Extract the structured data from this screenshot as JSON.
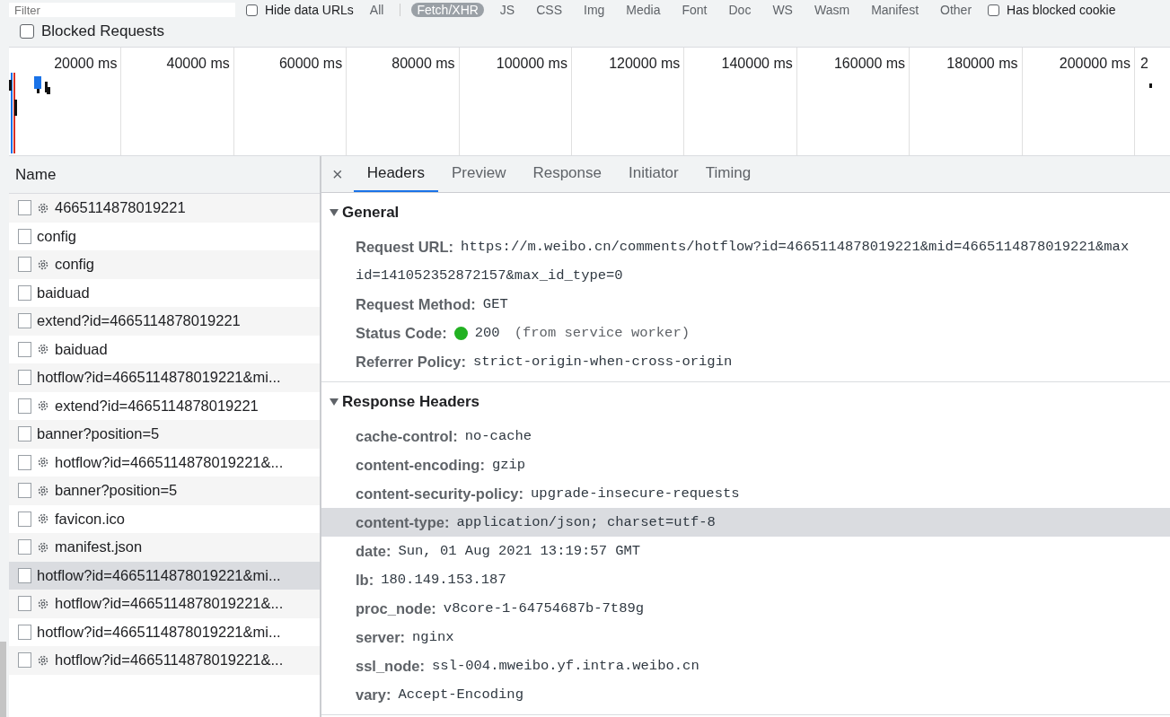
{
  "toolbar": {
    "filter": {
      "placeholder": "Filter"
    },
    "hide_data_urls": {
      "label": "Hide data URLs",
      "checked": false
    },
    "types": [
      {
        "label": "All",
        "selected": false
      },
      {
        "label": "Fetch/XHR",
        "selected": true
      },
      {
        "label": "JS",
        "selected": false
      },
      {
        "label": "CSS",
        "selected": false
      },
      {
        "label": "Img",
        "selected": false
      },
      {
        "label": "Media",
        "selected": false
      },
      {
        "label": "Font",
        "selected": false
      },
      {
        "label": "Doc",
        "selected": false
      },
      {
        "label": "WS",
        "selected": false
      },
      {
        "label": "Wasm",
        "selected": false
      },
      {
        "label": "Manifest",
        "selected": false
      },
      {
        "label": "Other",
        "selected": false
      }
    ],
    "has_blocked_cookies": {
      "label": "Has blocked cookie",
      "checked": false
    }
  },
  "blocked_requests": {
    "label": "Blocked Requests",
    "checked": false
  },
  "timeline": {
    "ticks": [
      "20000 ms",
      "40000 ms",
      "60000 ms",
      "80000 ms",
      "100000 ms",
      "120000 ms",
      "140000 ms",
      "160000 ms",
      "180000 ms",
      "200000 ms",
      "2"
    ]
  },
  "requests": {
    "column": "Name",
    "rows": [
      {
        "name": "4665114878019221",
        "service_worker": true,
        "selected": false
      },
      {
        "name": "config",
        "service_worker": false,
        "selected": false
      },
      {
        "name": "config",
        "service_worker": true,
        "selected": false
      },
      {
        "name": "baiduad",
        "service_worker": false,
        "selected": false
      },
      {
        "name": "extend?id=4665114878019221",
        "service_worker": false,
        "selected": false
      },
      {
        "name": "baiduad",
        "service_worker": true,
        "selected": false
      },
      {
        "name": "hotflow?id=4665114878019221&mi...",
        "service_worker": false,
        "selected": false
      },
      {
        "name": "extend?id=4665114878019221",
        "service_worker": true,
        "selected": false
      },
      {
        "name": "banner?position=5",
        "service_worker": false,
        "selected": false
      },
      {
        "name": "hotflow?id=4665114878019221&...",
        "service_worker": true,
        "selected": false
      },
      {
        "name": "banner?position=5",
        "service_worker": true,
        "selected": false
      },
      {
        "name": "favicon.ico",
        "service_worker": true,
        "selected": false
      },
      {
        "name": "manifest.json",
        "service_worker": true,
        "selected": false
      },
      {
        "name": "hotflow?id=4665114878019221&mi...",
        "service_worker": false,
        "selected": true
      },
      {
        "name": "hotflow?id=4665114878019221&...",
        "service_worker": true,
        "selected": false
      },
      {
        "name": "hotflow?id=4665114878019221&mi...",
        "service_worker": false,
        "selected": false
      },
      {
        "name": "hotflow?id=4665114878019221&...",
        "service_worker": true,
        "selected": false
      }
    ]
  },
  "details": {
    "close": "×",
    "tabs": [
      {
        "label": "Headers",
        "selected": true
      },
      {
        "label": "Preview",
        "selected": false
      },
      {
        "label": "Response",
        "selected": false
      },
      {
        "label": "Initiator",
        "selected": false
      },
      {
        "label": "Timing",
        "selected": false
      }
    ],
    "sections": [
      {
        "title": "General",
        "expanded": true,
        "rows": [
          {
            "key": "Request URL:",
            "value_lines": [
              "https://m.weibo.cn/comments/hotflow?id=4665114878019221&mid=4665114878019221&max",
              "id=141052352872157&max_id_type=0"
            ],
            "highlighted": false
          },
          {
            "key": "Request Method:",
            "value_lines": [
              "GET"
            ],
            "highlighted": false
          },
          {
            "key": "Status Code:",
            "value_lines": [
              "200"
            ],
            "note": "(from service worker)",
            "highlighted": false
          },
          {
            "key": "Referrer Policy:",
            "value_lines": [
              "strict-origin-when-cross-origin"
            ],
            "highlighted": false
          }
        ]
      },
      {
        "title": "Response Headers",
        "expanded": true,
        "rows": [
          {
            "key": "cache-control:",
            "value_lines": [
              "no-cache"
            ],
            "highlighted": false
          },
          {
            "key": "content-encoding:",
            "value_lines": [
              "gzip"
            ],
            "highlighted": false
          },
          {
            "key": "content-security-policy:",
            "value_lines": [
              "upgrade-insecure-requests"
            ],
            "highlighted": false
          },
          {
            "key": "content-type:",
            "value_lines": [
              "application/json; charset=utf-8"
            ],
            "highlighted": true
          },
          {
            "key": "date:",
            "value_lines": [
              "Sun, 01 Aug 2021 13:19:57 GMT"
            ],
            "highlighted": false
          },
          {
            "key": "lb:",
            "value_lines": [
              "180.149.153.187"
            ],
            "highlighted": false
          },
          {
            "key": "proc_node:",
            "value_lines": [
              "v8core-1-64754687b-7t89g"
            ],
            "highlighted": false
          },
          {
            "key": "server:",
            "value_lines": [
              "nginx"
            ],
            "highlighted": false
          },
          {
            "key": "ssl_node:",
            "value_lines": [
              "ssl-004.mweibo.yf.intra.weibo.cn"
            ],
            "highlighted": false
          },
          {
            "key": "vary:",
            "value_lines": [
              "Accept-Encoding"
            ],
            "highlighted": false
          }
        ]
      }
    ]
  }
}
